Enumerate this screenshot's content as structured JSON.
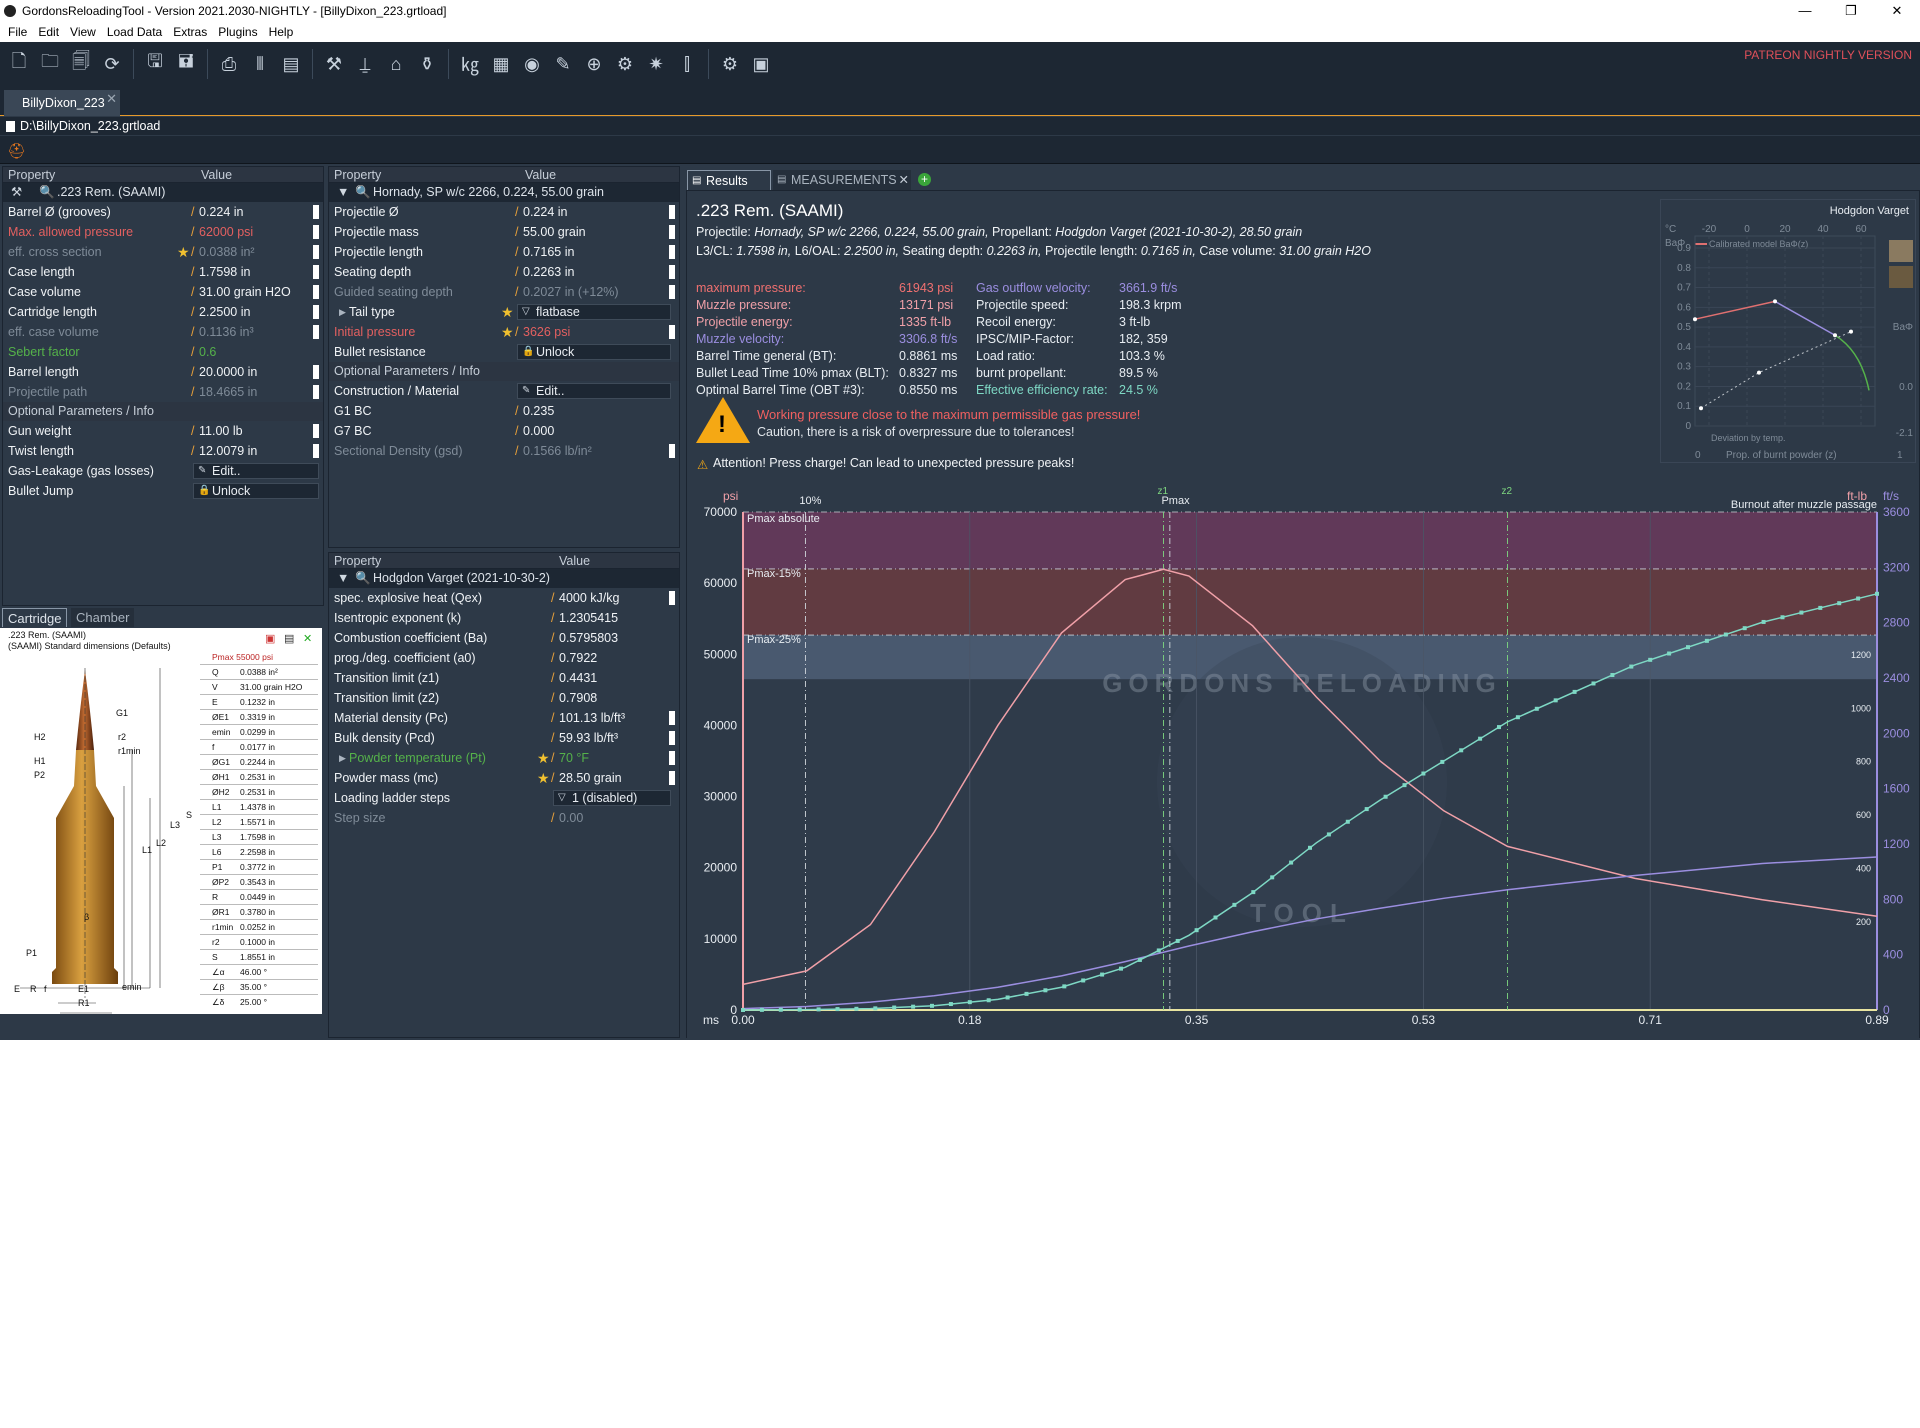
{
  "window": {
    "title": "GordonsReloadingTool - Version 2021.2030-NIGHTLY - [BillyDixon_223.grtload]",
    "min": "—",
    "max": "❐",
    "close": "✕"
  },
  "menu": [
    "File",
    "Edit",
    "View",
    "Load Data",
    "Extras",
    "Plugins",
    "Help"
  ],
  "toolbar": {
    "patreon": "PATREON NIGHTLY VERSION"
  },
  "doc": {
    "tab": "BillyDixon_223",
    "path": "D:\\BillyDixon_223.grtload"
  },
  "cartridge_panel": {
    "header": {
      "property": "Property",
      "value": "Value"
    },
    "group": ".223 Rem. (SAAMI)",
    "rows": [
      {
        "k": "Barrel Ø (grooves)",
        "v": "0.224 in"
      },
      {
        "k": "Max. allowed pressure",
        "v": "62000 psi"
      },
      {
        "k": "eff. cross section",
        "v": "0.0388 in²"
      },
      {
        "k": "Case length",
        "v": "1.7598 in"
      },
      {
        "k": "Case volume",
        "v": "31.00 grain H2O"
      },
      {
        "k": "Cartridge length",
        "v": "2.2500 in"
      },
      {
        "k": "eff. case volume",
        "v": "0.1136 in³"
      },
      {
        "k": "Sebert factor",
        "v": "0.6"
      },
      {
        "k": "Barrel length",
        "v": "20.0000 in"
      },
      {
        "k": "Projectile path",
        "v": "18.4665 in"
      }
    ],
    "optional_header": "Optional Parameters / Info",
    "opt_rows": [
      {
        "k": "Gun weight",
        "v": "11.00 lb"
      },
      {
        "k": "Twist length",
        "v": "12.0079 in"
      },
      {
        "k": "Gas-Leakage (gas losses)",
        "v": "Edit.."
      },
      {
        "k": "Bullet Jump",
        "v": "Unlock"
      }
    ]
  },
  "projectile_panel": {
    "header": {
      "property": "Property",
      "value": "Value"
    },
    "group": "Hornady, SP w/c 2266, 0.224, 55.00 grain",
    "rows": [
      {
        "k": "Projectile Ø",
        "v": "0.224 in"
      },
      {
        "k": "Projectile mass",
        "v": "55.00 grain"
      },
      {
        "k": "Projectile length",
        "v": "0.7165 in"
      },
      {
        "k": "Seating depth",
        "v": "0.2263 in"
      },
      {
        "k": "Guided seating depth",
        "v": "0.2027 in (+12%)"
      },
      {
        "k": "Tail type",
        "v": "flatbase"
      },
      {
        "k": "Initial pressure",
        "v": "3626 psi"
      },
      {
        "k": "Bullet resistance",
        "v": "Unlock"
      }
    ],
    "optional_header": "Optional Parameters / Info",
    "opt_rows": [
      {
        "k": "Construction / Material",
        "v": "Edit.."
      },
      {
        "k": "G1 BC",
        "v": "0.235"
      },
      {
        "k": "G7 BC",
        "v": "0.000"
      },
      {
        "k": "Sectional Density (gsd)",
        "v": "0.1566 lb/in²"
      }
    ]
  },
  "powder_panel": {
    "header": {
      "property": "Property",
      "value": "Value"
    },
    "group": "Hodgdon Varget (2021-10-30-2)",
    "rows": [
      {
        "k": "spec. explosive heat (Qex)",
        "v": "4000 kJ/kg"
      },
      {
        "k": "Isentropic exponent (k)",
        "v": "1.2305415"
      },
      {
        "k": "Combustion coefficient (Ba)",
        "v": "0.5795803"
      },
      {
        "k": "prog./deg. coefficient (a0)",
        "v": "0.7922"
      },
      {
        "k": "Transition limit (z1)",
        "v": "0.4431"
      },
      {
        "k": "Transition limit (z2)",
        "v": "0.7908"
      },
      {
        "k": "Material density (Pc)",
        "v": "101.13 lb/ft³"
      },
      {
        "k": "Bulk density (Pcd)",
        "v": "59.93 lb/ft³"
      },
      {
        "k": "Powder temperature (Pt)",
        "v": "70 °F"
      },
      {
        "k": "Powder mass (mc)",
        "v": "28.50 grain"
      },
      {
        "k": "Loading ladder steps",
        "v": "1 (disabled)"
      },
      {
        "k": "Step size",
        "v": "0.00"
      }
    ]
  },
  "drawing": {
    "tab_cartridge": "Cartridge",
    "tab_chamber": "Chamber",
    "title": ".223 Rem. (SAAMI)",
    "subtitle": "(SAAMI) Standard dimensions (Defaults)",
    "pmax": "Pmax 55000 psi",
    "table": [
      [
        "Q",
        "0.0388 in²"
      ],
      [
        "V",
        "31.00 grain H2O"
      ],
      [
        "E",
        "0.1232 in"
      ],
      [
        "ØE1",
        "0.3319 in"
      ],
      [
        "emin",
        "0.0299 in"
      ],
      [
        "f",
        "0.0177 in"
      ],
      [
        "ØG1",
        "0.2244 in"
      ],
      [
        "ØH1",
        "0.2531 in"
      ],
      [
        "ØH2",
        "0.2531 in"
      ],
      [
        "L1",
        "1.4378 in"
      ],
      [
        "L2",
        "1.5571 in"
      ],
      [
        "L3",
        "1.7598 in"
      ],
      [
        "L6",
        "2.2598 in"
      ],
      [
        "P1",
        "0.3772 in"
      ],
      [
        "ØP2",
        "0.3543 in"
      ],
      [
        "R",
        "0.0449 in"
      ],
      [
        "ØR1",
        "0.3780 in"
      ],
      [
        "r1min",
        "0.0252 in"
      ],
      [
        "r2",
        "0.1000 in"
      ],
      [
        "S",
        "1.8551 in"
      ],
      [
        "∠α",
        "46.00 °"
      ],
      [
        "∠β",
        "35.00 °"
      ],
      [
        "∠δ",
        "25.00 °"
      ]
    ],
    "labels": {
      "G1": "G1",
      "H2": "H2",
      "r2": "r2",
      "r1min": "r1min",
      "H1": "H1",
      "P2": "P2",
      "L1": "L1",
      "L2": "L2",
      "L3": "L3",
      "S": "S",
      "P1": "P1",
      "E": "E",
      "R": "R",
      "f": "f",
      "E1": "E1",
      "R1": "R1",
      "emin": "emin",
      "beta": "β"
    }
  },
  "results": {
    "tab_results": "Results",
    "tab_measurements": "MEASUREMENTS",
    "title": ".223 Rem. (SAAMI)",
    "line1_a": "Projectile:",
    "line1_b": "Hornady, SP w/c 2266, 0.224, 55.00 grain,",
    "line1_c": "Propellant:",
    "line1_d": "Hodgdon Varget (2021-10-30-2), 28.50 grain",
    "line2": [
      [
        "L3/CL:",
        "1.7598 in,"
      ],
      [
        "L6/OAL:",
        "2.2500 in,"
      ],
      [
        "Seating depth:",
        "0.2263 in,"
      ],
      [
        "Projectile length:",
        "0.7165 in,"
      ],
      [
        "Case volume:",
        "31.00 grain H2O"
      ]
    ],
    "left": [
      [
        "maximum pressure:",
        "61943 psi"
      ],
      [
        "Muzzle pressure:",
        "13171 psi"
      ],
      [
        "Projectile energy:",
        "1335 ft-lb"
      ],
      [
        "Muzzle velocity:",
        "3306.8 ft/s"
      ],
      [
        "Barrel Time general (BT):",
        "0.8861 ms"
      ],
      [
        "Bullet Lead Time 10% pmax (BLT):",
        "0.8327 ms"
      ],
      [
        "Optimal Barrel Time (OBT #3):",
        "0.8550 ms"
      ]
    ],
    "right": [
      [
        "Gas outflow velocity:",
        "3661.9 ft/s"
      ],
      [
        "Projectile speed:",
        "198.3 krpm"
      ],
      [
        "Recoil energy:",
        "3 ft-lb"
      ],
      [
        "IPSC/MIP-Factor:",
        "182, 359"
      ],
      [
        "Load ratio:",
        "103.3 %"
      ],
      [
        "burnt propellant:",
        "89.5 %"
      ],
      [
        "Effective efficiency rate:",
        "24.5 %"
      ]
    ],
    "warn1": "Working pressure close to the maximum permissible gas pressure!",
    "warn2": "Caution, there is a risk of overpressure due to tolerances!",
    "warn3": "Attention! Press charge! Can lead to unexpected pressure peaks!"
  },
  "minichart": {
    "title": "Hodgdon Varget",
    "legend1": "Calibrated model BaΦ(z)",
    "legend2": "Deviation by temp.",
    "xlabel": "Prop. of burnt powder (z)",
    "ylabel": "BaΦ",
    "top_unit": "°C",
    "top_ticks": [
      "-20",
      "0",
      "20",
      "40",
      "60"
    ],
    "y_ticks": [
      "0.9",
      "0.8",
      "0.7",
      "0.6",
      "0.5",
      "0.4",
      "0.3",
      "0.2",
      "0.1",
      "0"
    ],
    "x_start": "0",
    "x_end": "1",
    "r1": "0.0",
    "r2": "-2.1"
  },
  "chart_data": {
    "type": "line",
    "x_unit": "ms",
    "x_ticks": [
      "0.00",
      "0.18",
      "0.35",
      "0.53",
      "0.71",
      "0.89"
    ],
    "x_range": [
      0,
      0.89
    ],
    "y_left_unit": "psi",
    "y_left_ticks": [
      "70000",
      "60000",
      "50000",
      "40000",
      "30000",
      "20000",
      "10000",
      "0"
    ],
    "y_left_range": [
      0,
      70000
    ],
    "y_right1_unit": "ft-lb",
    "y_right1_ticks": [
      "1200",
      "1000",
      "800",
      "600",
      "400",
      "200"
    ],
    "y_right2_unit": "ft/s",
    "y_right2_ticks": [
      "3600",
      "3200",
      "2800",
      "2400",
      "2000",
      "1600",
      "1200",
      "800",
      "400",
      "0"
    ],
    "bands": [
      {
        "label": "Pmax absolute",
        "from": 62000,
        "to": 70000,
        "color": "#6a3a5c"
      },
      {
        "label": "Pmax-15%",
        "from": 52700,
        "to": 62000,
        "color": "#6a3c40"
      },
      {
        "label": "Pmax-25%",
        "from": 46500,
        "to": 52700,
        "color": "#4d5f75"
      }
    ],
    "markers": {
      "p10": "10%",
      "z1": "z1",
      "pmax": "Pmax",
      "z2": "z2",
      "burnout": "Burnout after muzzle passage"
    },
    "series": [
      {
        "color": "#f0a0a8",
        "x": [
          0,
          0.05,
          0.1,
          0.15,
          0.2,
          0.25,
          0.3,
          0.33,
          0.35,
          0.4,
          0.45,
          0.5,
          0.55,
          0.6,
          0.7,
          0.8,
          0.89
        ],
        "y": [
          3600,
          5500,
          12000,
          25000,
          40000,
          53000,
          60500,
          61943,
          61000,
          54000,
          44000,
          35000,
          28000,
          23000,
          18500,
          15500,
          13171
        ]
      },
      {
        "color": "#9b8ee0",
        "x": [
          0,
          0.05,
          0.1,
          0.15,
          0.2,
          0.25,
          0.3,
          0.35,
          0.4,
          0.45,
          0.5,
          0.55,
          0.6,
          0.7,
          0.8,
          0.89
        ],
        "y": [
          200,
          500,
          1100,
          2000,
          3200,
          4800,
          6800,
          9000,
          11000,
          12800,
          14300,
          15700,
          16900,
          18900,
          20600,
          21500
        ]
      },
      {
        "color": "#7ed8c4",
        "x": [
          0,
          0.05,
          0.1,
          0.15,
          0.2,
          0.25,
          0.3,
          0.35,
          0.4,
          0.45,
          0.5,
          0.55,
          0.6,
          0.7,
          0.8,
          0.89
        ],
        "y": [
          0,
          60,
          200,
          600,
          1500,
          3200,
          6000,
          10500,
          16500,
          23500,
          29500,
          35000,
          40500,
          48500,
          54500,
          58500
        ]
      }
    ]
  },
  "watermark": {
    "top": "GORDONS RELOADING",
    "bottom": "TOOL"
  }
}
